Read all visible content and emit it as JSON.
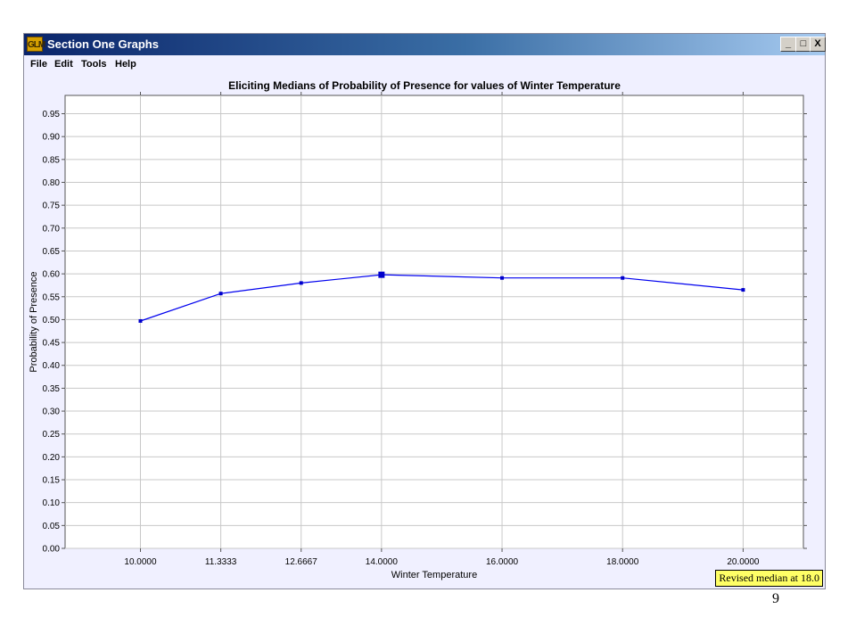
{
  "window": {
    "app_icon_text": "GLM",
    "title": "Section One Graphs",
    "controls": {
      "minimize": "_",
      "maximize": "□",
      "close": "X"
    }
  },
  "menu": [
    "File",
    "Edit",
    "Tools",
    "Help"
  ],
  "status_label": "Revised median at 18.0",
  "page_number": "9",
  "chart_data": {
    "type": "line",
    "title": "Eliciting Medians of Probability of Presence for values of Winter Temperature",
    "xlabel": "Winter Temperature",
    "ylabel": "Probability of Presence",
    "x": [
      10.0,
      11.3333,
      12.6667,
      14.0,
      16.0,
      18.0,
      20.0
    ],
    "x_tick_labels": [
      "10.0000",
      "11.3333",
      "12.6667",
      "14.0000",
      "16.0000",
      "18.0000",
      "20.0000"
    ],
    "y": [
      0.497,
      0.557,
      0.58,
      0.598,
      0.591,
      0.591,
      0.565
    ],
    "highlighted_point_index": 3,
    "xlim": [
      8.75,
      21.0
    ],
    "ylim": [
      0.0,
      0.99
    ],
    "y_ticks": [
      "0.00",
      "0.05",
      "0.10",
      "0.15",
      "0.20",
      "0.25",
      "0.30",
      "0.35",
      "0.40",
      "0.45",
      "0.50",
      "0.55",
      "0.60",
      "0.65",
      "0.70",
      "0.75",
      "0.80",
      "0.85",
      "0.90",
      "0.95"
    ],
    "grid": true,
    "line_color": "#0000ee",
    "marker_color": "#0000cc",
    "grid_color": "#c8c8c8"
  }
}
